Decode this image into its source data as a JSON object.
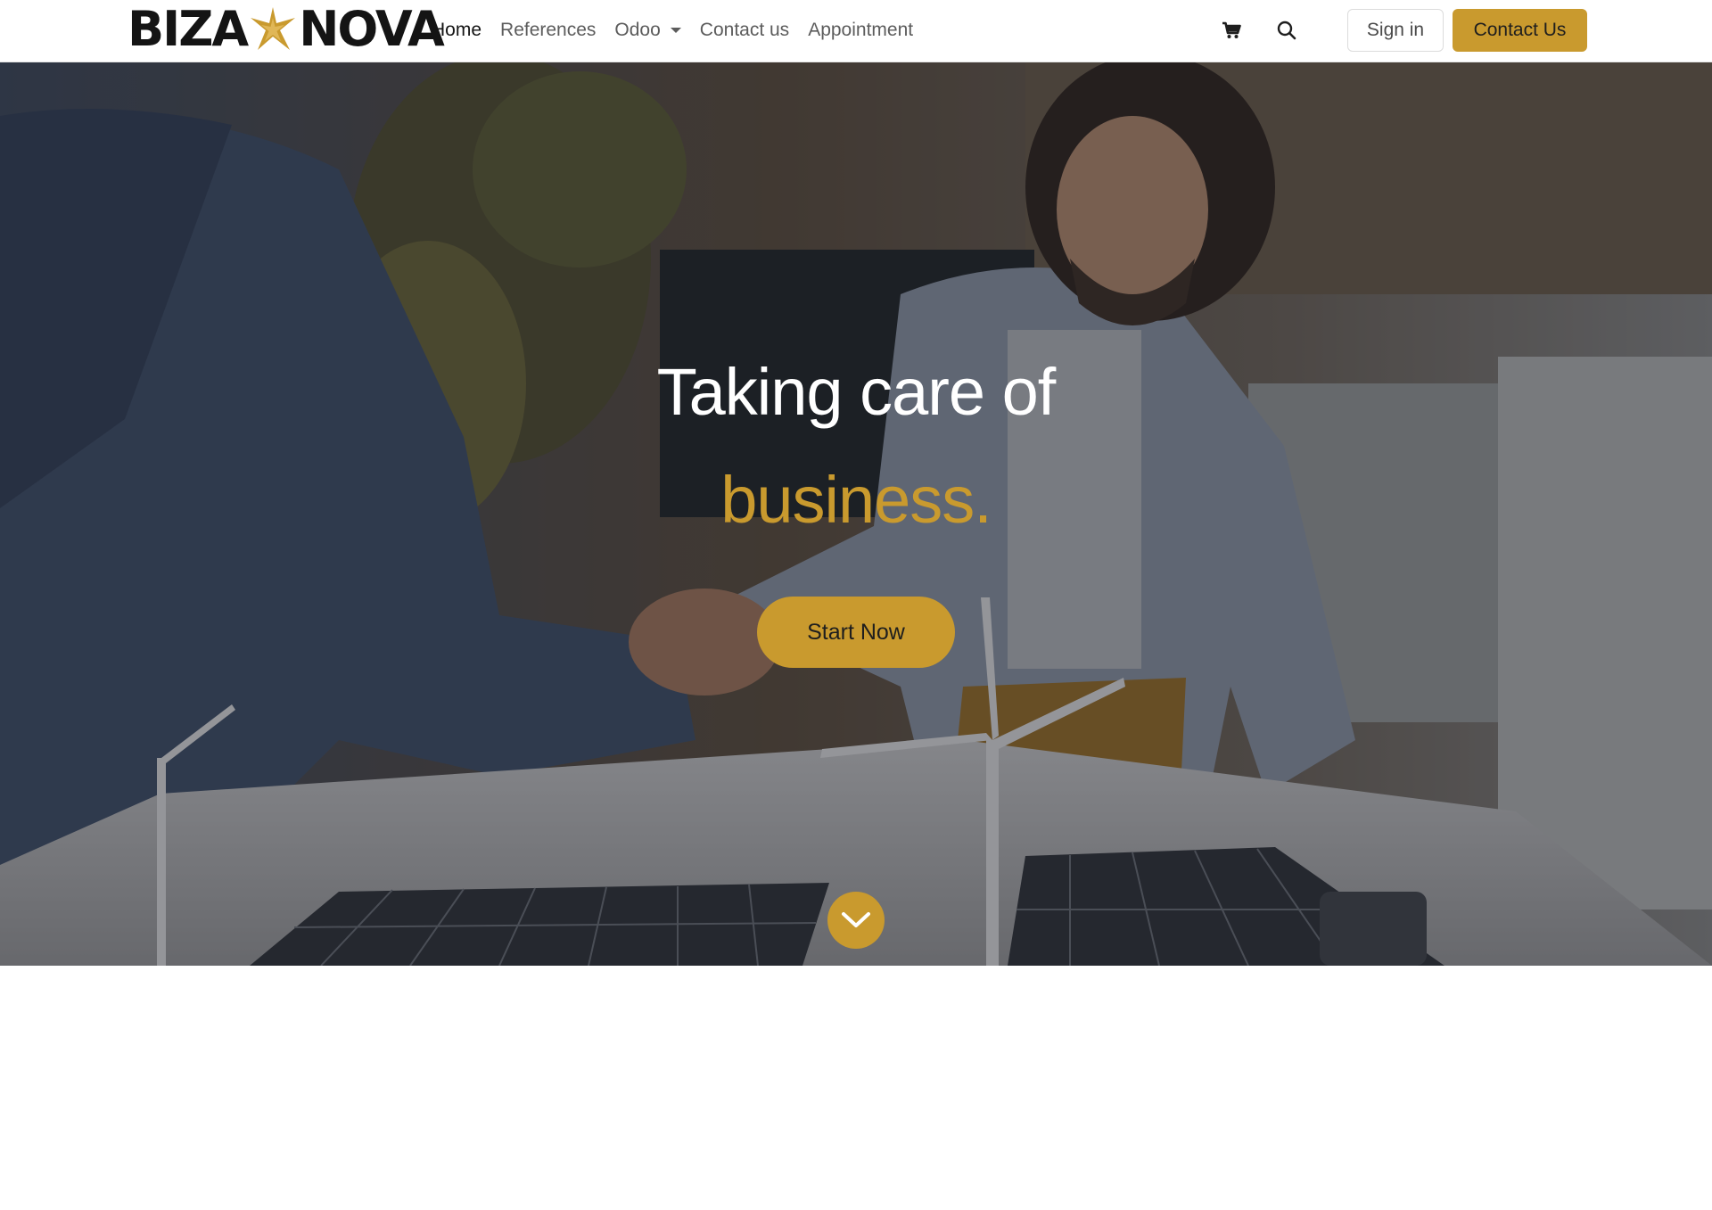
{
  "brand": {
    "logo_left": "BIZA",
    "logo_right": "NOVA",
    "logo_star_color": "#c99a2e"
  },
  "nav": {
    "items": [
      {
        "label": "Home",
        "active": true
      },
      {
        "label": "References",
        "active": false
      },
      {
        "label": "Odoo",
        "active": false,
        "has_dropdown": true
      },
      {
        "label": "Contact us",
        "active": false
      },
      {
        "label": "Appointment",
        "active": false
      }
    ],
    "cart_icon": "shopping-cart-icon",
    "search_icon": "search-icon",
    "sign_in_label": "Sign in",
    "contact_label": "Contact Us"
  },
  "hero": {
    "title_line1": "Taking care of",
    "title_line2": "business.",
    "cta_label": "Start Now",
    "scroll_icon": "chevron-down-icon",
    "background_image": "handshake-office-photo"
  },
  "colors": {
    "accent": "#c99a2e",
    "text_dark": "#141414",
    "nav_text": "#5c5c5c"
  }
}
